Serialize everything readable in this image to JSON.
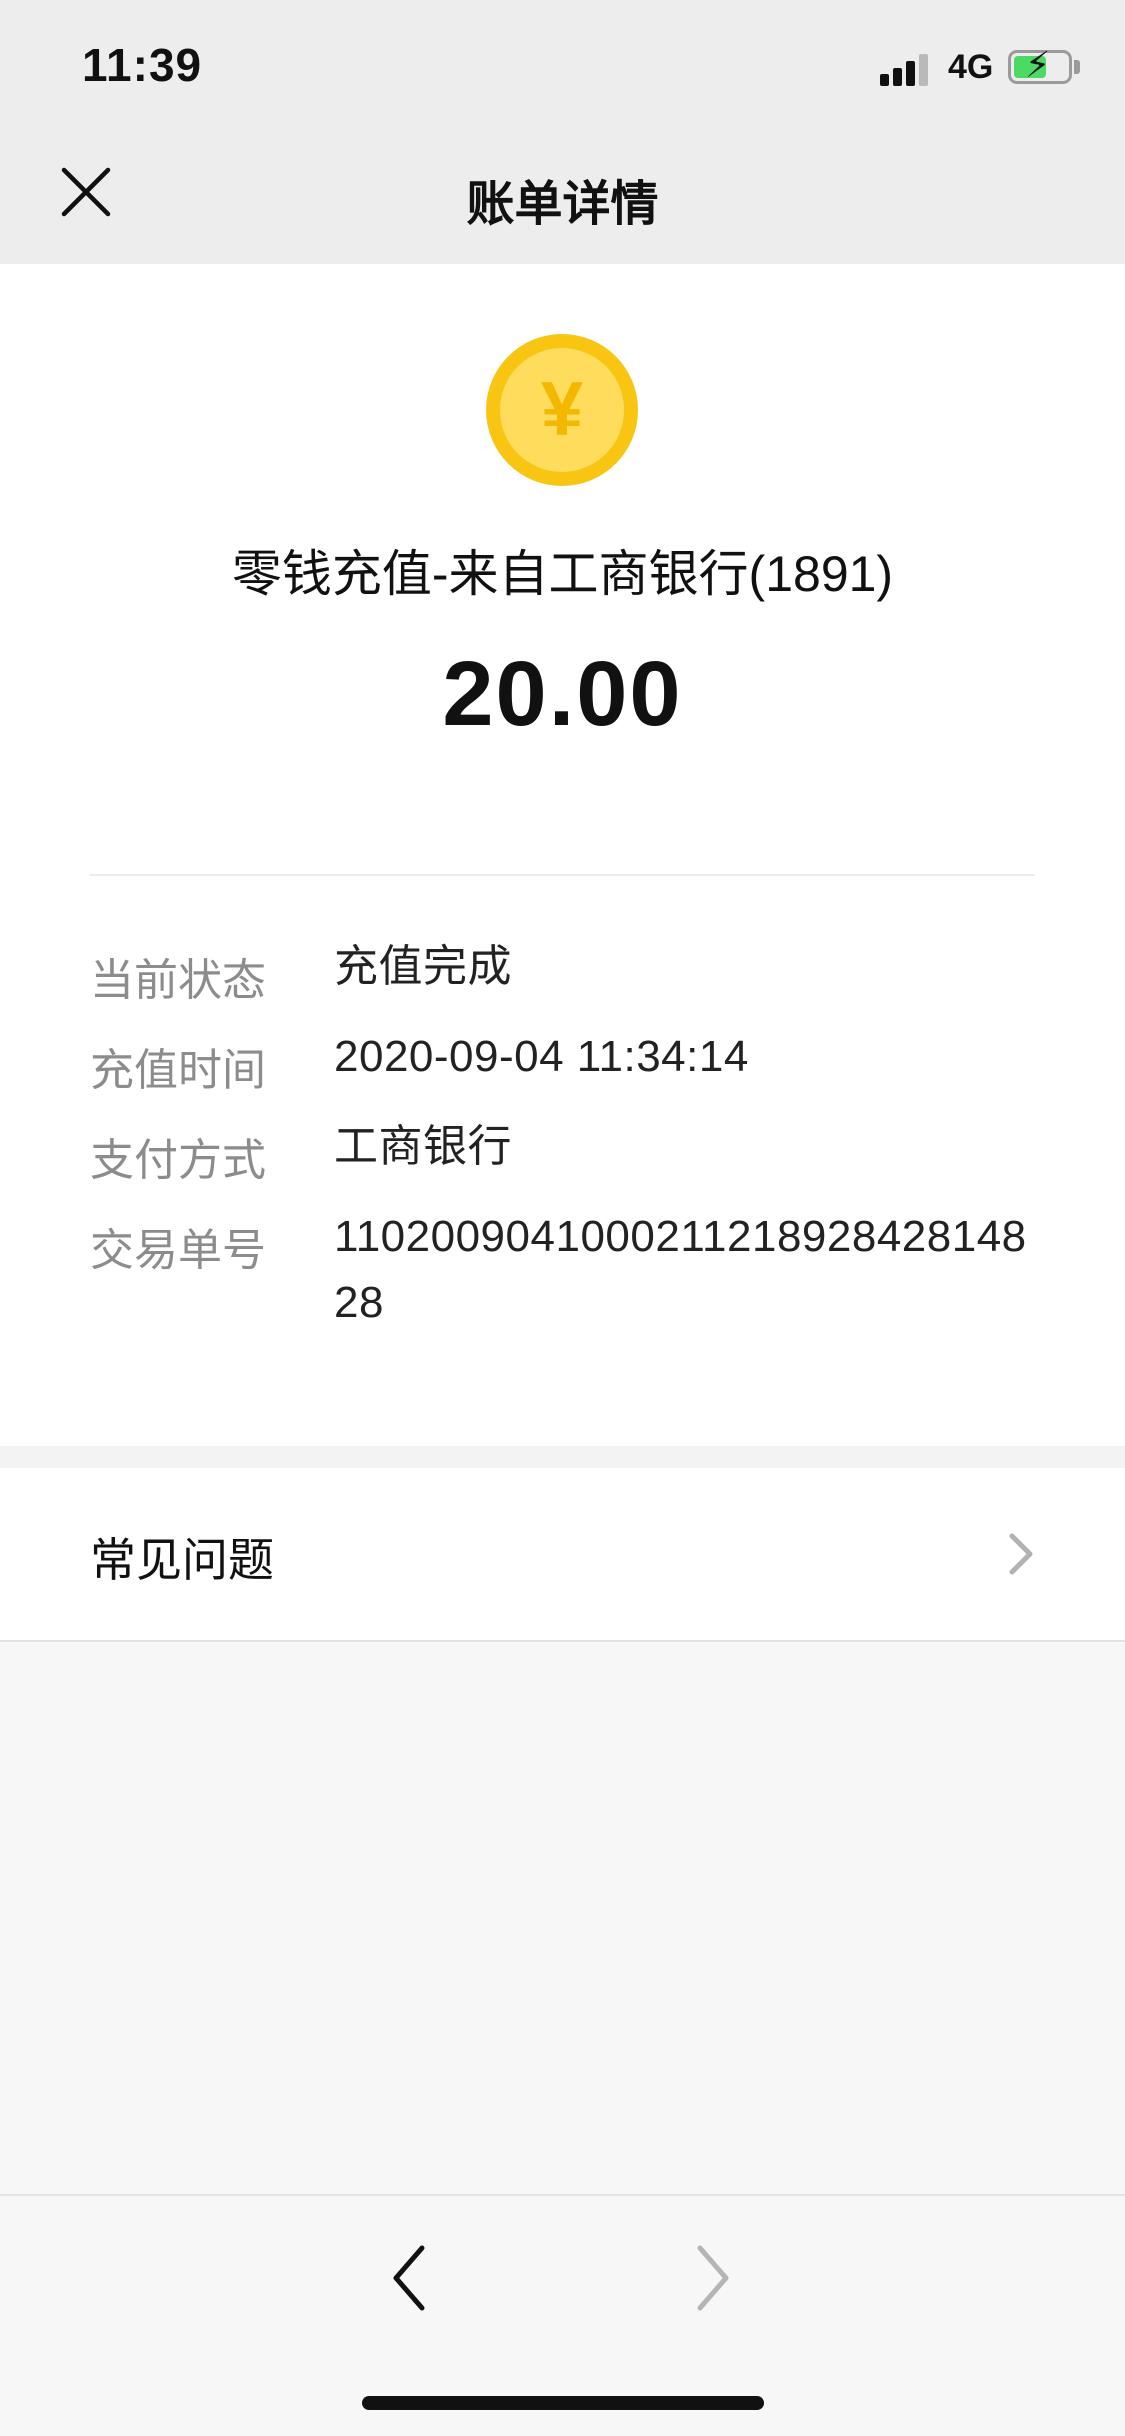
{
  "status_bar": {
    "time": "11:39",
    "network": "4G",
    "icons": [
      "signal-icon",
      "battery-charging-icon"
    ]
  },
  "nav": {
    "title": "账单详情",
    "close_icon": "close-icon"
  },
  "bill": {
    "icon": "yuan-coin-icon",
    "coin_symbol": "¥",
    "title": "零钱充值-来自工商银行(1891)",
    "amount": "20.00"
  },
  "details": [
    {
      "label": "当前状态",
      "value": "充值完成"
    },
    {
      "label": "充值时间",
      "value": "2020-09-04 11:34:14"
    },
    {
      "label": "支付方式",
      "value": "工商银行"
    },
    {
      "label": "交易单号",
      "value": "110200904100021121892842814828"
    }
  ],
  "faq": {
    "label": "常见问题",
    "icon": "chevron-right-icon"
  },
  "toolbar": {
    "back_icon": "chevron-left-icon",
    "forward_icon": "chevron-right-icon"
  },
  "colors": {
    "coin_outer": "#f8c612",
    "coin_inner": "#ffdc5c",
    "battery_fill": "#4cd964",
    "background": "#ededed"
  }
}
